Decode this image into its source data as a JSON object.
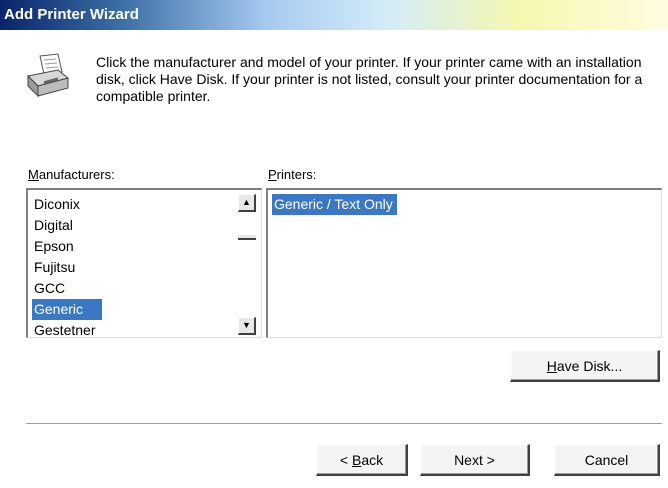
{
  "window": {
    "title": "Add Printer Wizard"
  },
  "header": {
    "icon": "printer-icon",
    "instructions": "Click the manufacturer and model of your printer. If your printer came with an installation disk, click Have Disk. If your printer is not listed, consult your printer documentation for a compatible printer."
  },
  "manufacturers": {
    "label_prefix": "M",
    "label_rest": "anufacturers:",
    "items": [
      "Diconix",
      "Digital",
      "Epson",
      "Fujitsu",
      "GCC",
      "Generic",
      "Gestetner"
    ],
    "selected": "Generic"
  },
  "printers": {
    "label_prefix": "P",
    "label_rest": "rinters:",
    "items": [
      "Generic / Text Only"
    ],
    "selected": "Generic / Text Only"
  },
  "buttons": {
    "have_disk_prefix": "H",
    "have_disk_rest": "ave Disk...",
    "back_arrow": "< ",
    "back_prefix": "B",
    "back_rest": "ack",
    "next": "Next >",
    "cancel": "Cancel"
  },
  "colors": {
    "selection": "#3a78c3",
    "title_text": "#ffffff"
  }
}
